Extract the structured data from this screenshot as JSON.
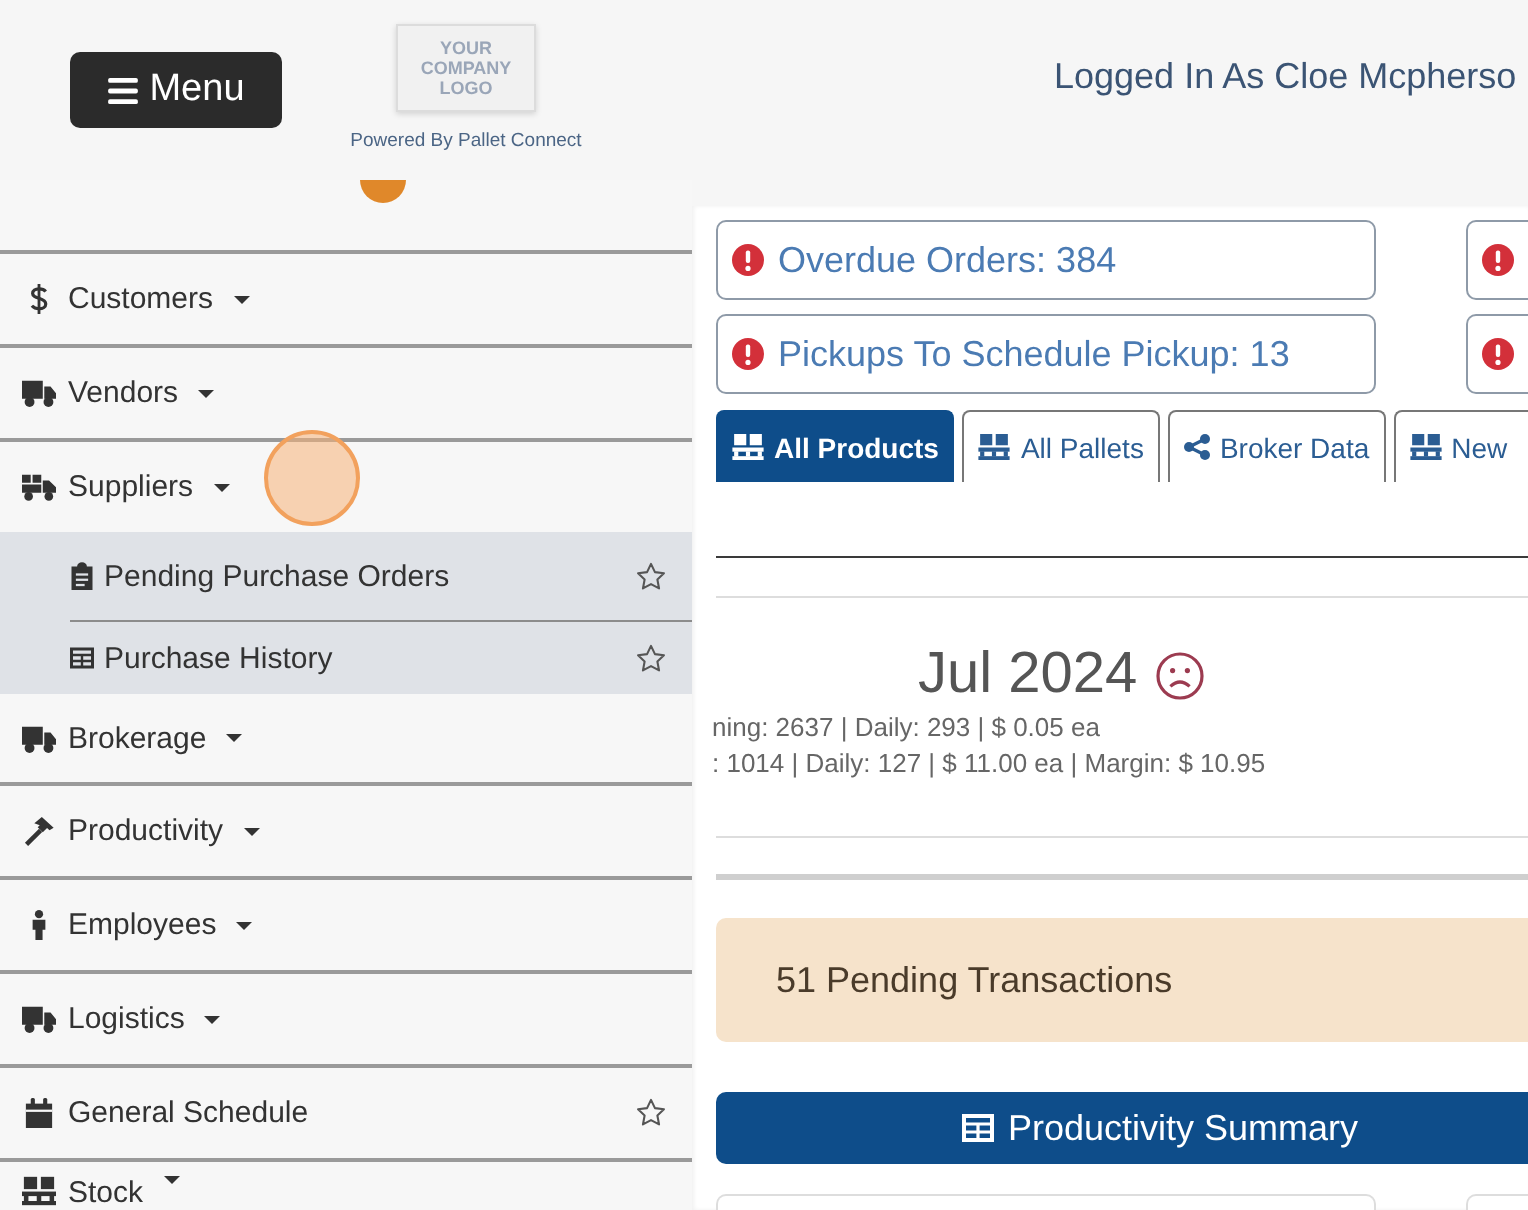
{
  "header": {
    "menu_button": {
      "label": "Menu"
    },
    "logo": {
      "text": "YOUR COMPANY LOGO"
    },
    "powered_by": "Powered By Pallet Connect",
    "user": "Logged In As Cloe Mcpherso"
  },
  "click_marker": true,
  "sidebar": {
    "clipped_item": {
      "badge": true
    },
    "items": [
      {
        "kind": "menu",
        "label": "Customers"
      },
      {
        "kind": "menu",
        "label": "Vendors"
      },
      {
        "kind": "menu",
        "label": "Suppliers",
        "children": [
          {
            "label": "Pending Purchase Orders",
            "starred": false
          },
          {
            "label": "Purchase History",
            "starred": false
          }
        ]
      },
      {
        "kind": "menu",
        "label": "Brokerage"
      },
      {
        "kind": "menu",
        "label": "Productivity"
      },
      {
        "kind": "menu",
        "label": "Employees"
      },
      {
        "kind": "menu",
        "label": "Logistics"
      },
      {
        "kind": "link",
        "label": "General Schedule",
        "starred": false
      },
      {
        "kind": "menu",
        "label": "Stock"
      }
    ]
  },
  "main": {
    "alerts": [
      {
        "kind": "full",
        "label": "Overdue Orders: 384"
      },
      {
        "kind": "clipped"
      },
      {
        "kind": "full",
        "label": "Pickups To Schedule Pickup: 13"
      },
      {
        "kind": "clipped"
      }
    ],
    "tabs": [
      {
        "label": "All Products",
        "selected": true
      },
      {
        "label": "All Pallets",
        "selected": false
      },
      {
        "label": "Broker Data",
        "selected": false
      },
      {
        "label": "New",
        "selected": false
      }
    ],
    "month_summary": {
      "title": "Jul 2024",
      "lines": [
        "ning: 2637 | Daily: 293 | $ 0.05 ea",
        ": 1014 | Daily: 127 | $ 11.00 ea | Margin: $ 10.95"
      ]
    },
    "pending_notice": "51 Pending Transactions",
    "section_header": {
      "title": "Productivity Summary"
    }
  }
}
